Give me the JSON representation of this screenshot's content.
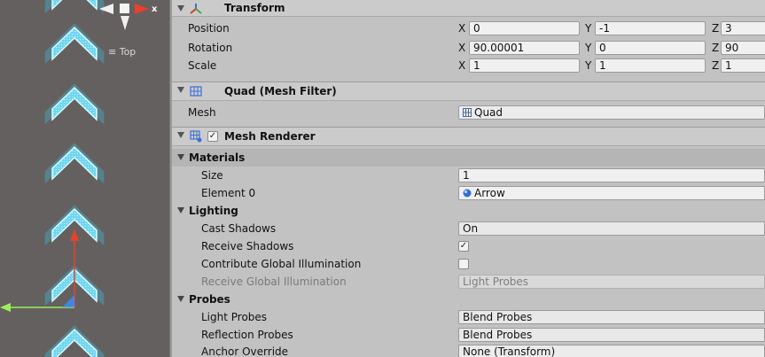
{
  "scene": {
    "view_label": "Top",
    "gizmo_axis_label": "x"
  },
  "inspector": {
    "transform": {
      "title": "Transform",
      "position": {
        "label": "Position",
        "x": "0",
        "y": "-1",
        "z": "3"
      },
      "rotation": {
        "label": "Rotation",
        "x": "90.00001",
        "y": "0",
        "z": "90"
      },
      "scale": {
        "label": "Scale",
        "x": "1",
        "y": "1",
        "z": "1"
      },
      "axis_labels": {
        "x": "X",
        "y": "Y",
        "z": "Z"
      }
    },
    "mesh_filter": {
      "title": "Quad (Mesh Filter)",
      "mesh_label": "Mesh",
      "mesh_value": "Quad"
    },
    "mesh_renderer": {
      "title": "Mesh Renderer",
      "enabled": true,
      "materials": {
        "header": "Materials",
        "size_label": "Size",
        "size_value": "1",
        "element0_label": "Element 0",
        "element0_value": "Arrow"
      },
      "lighting": {
        "header": "Lighting",
        "cast_shadows_label": "Cast Shadows",
        "cast_shadows_value": "On",
        "receive_shadows_label": "Receive Shadows",
        "receive_shadows_checked": true,
        "contribute_gi_label": "Contribute Global Illumination",
        "contribute_gi_checked": false,
        "receive_gi_label": "Receive Global Illumination",
        "receive_gi_value": "Light Probes"
      },
      "probes": {
        "header": "Probes",
        "light_probes_label": "Light Probes",
        "light_probes_value": "Blend Probes",
        "reflection_probes_label": "Reflection Probes",
        "reflection_probes_value": "Blend Probes",
        "anchor_override_label": "Anchor Override",
        "anchor_override_value": "None (Transform)"
      }
    }
  },
  "colors": {
    "scene_bg": "#646060",
    "arrow_glow": "#5fd0e8",
    "gizmo_red": "#e8402a",
    "gizmo_green": "#9cf05a",
    "material_blue": "#2f6fd6"
  },
  "icons": [
    "transform-icon",
    "mesh-filter-icon",
    "mesh-renderer-icon",
    "material-icon",
    "mesh-icon"
  ]
}
